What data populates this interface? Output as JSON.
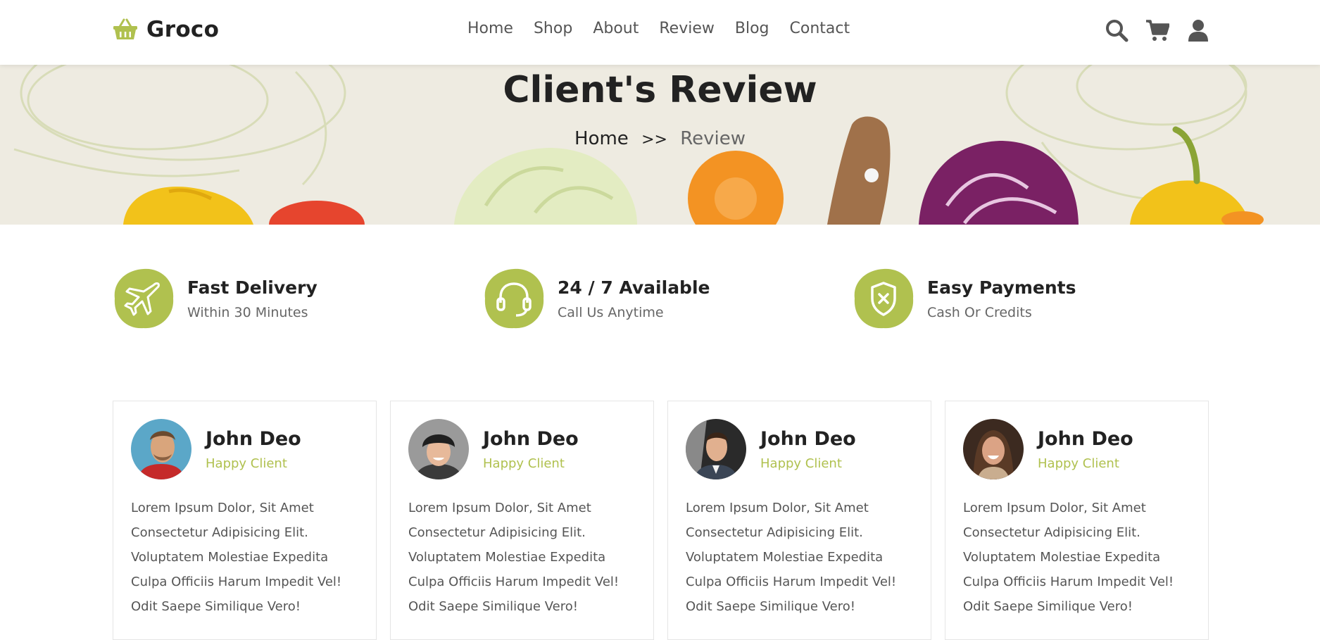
{
  "brand": {
    "name": "Groco",
    "accent_color": "#b0c14f"
  },
  "nav": {
    "items": [
      "Home",
      "Shop",
      "About",
      "Review",
      "Blog",
      "Contact"
    ]
  },
  "header_icons": [
    "search-icon",
    "cart-icon",
    "user-icon"
  ],
  "hero": {
    "title": "Client's Review",
    "breadcrumb": {
      "home": "Home",
      "separator": ">>",
      "current": "Review"
    }
  },
  "features": [
    {
      "icon": "plane-icon",
      "title": "Fast Delivery",
      "subtitle": "Within 30 Minutes"
    },
    {
      "icon": "headset-icon",
      "title": "24 / 7 Available",
      "subtitle": "Call Us Anytime"
    },
    {
      "icon": "shield-icon",
      "title": "Easy Payments",
      "subtitle": "Cash Or Credits"
    }
  ],
  "reviews": [
    {
      "name": "John Deo",
      "role": "Happy Client",
      "text": "Lorem Ipsum Dolor, Sit Amet Consectetur Adipisicing Elit. Voluptatem Molestiae Expedita Culpa Officiis Harum Impedit Vel! Odit Saepe Similique Vero!"
    },
    {
      "name": "John Deo",
      "role": "Happy Client",
      "text": "Lorem Ipsum Dolor, Sit Amet Consectetur Adipisicing Elit. Voluptatem Molestiae Expedita Culpa Officiis Harum Impedit Vel! Odit Saepe Similique Vero!"
    },
    {
      "name": "John Deo",
      "role": "Happy Client",
      "text": "Lorem Ipsum Dolor, Sit Amet Consectetur Adipisicing Elit. Voluptatem Molestiae Expedita Culpa Officiis Harum Impedit Vel! Odit Saepe Similique Vero!"
    },
    {
      "name": "John Deo",
      "role": "Happy Client",
      "text": "Lorem Ipsum Dolor, Sit Amet Consectetur Adipisicing Elit. Voluptatem Molestiae Expedita Culpa Officiis Harum Impedit Vel! Odit Saepe Similique Vero!"
    }
  ]
}
